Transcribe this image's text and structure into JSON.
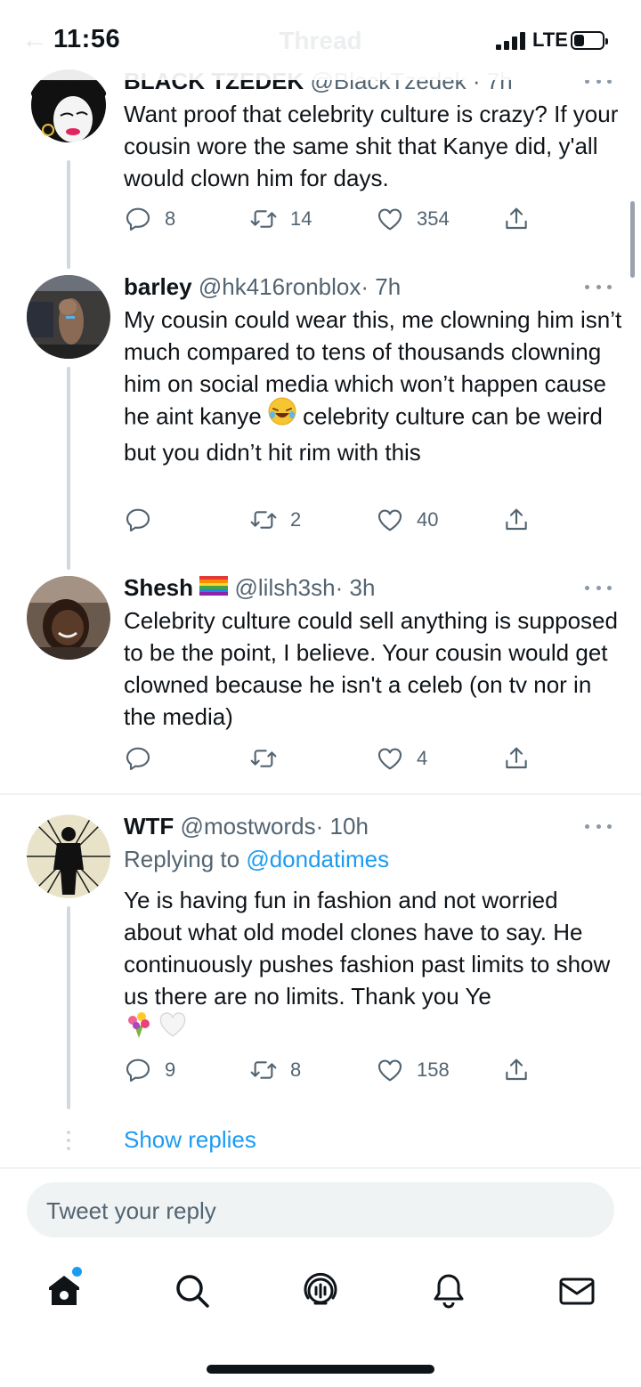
{
  "status_bar": {
    "time": "11:56",
    "network": "LTE",
    "ghost_title": "Thread",
    "battery_level": 0.35
  },
  "colors": {
    "accent": "#1d9bf0",
    "text": "#0f1419",
    "secondary": "#536471"
  },
  "tweets": [
    {
      "name": "BLACK TZEDEK",
      "handle": "@BlackTzedek",
      "time": "· 7h",
      "text": "Want proof that celebrity culture is crazy? If your cousin wore the same shit that Kanye did, y'all would clown him for days.",
      "replies": "8",
      "retweets": "14",
      "likes": "354"
    },
    {
      "name": "barley",
      "handle": "@hk416ronblox",
      "time": "· 7h",
      "text_before": "My cousin could wear this, me clowning him isn’t much compared to tens of thousands clowning him on social media which won’t happen cause he aint kanye ",
      "text_after": " celebrity culture can be weird but you didn’t hit rim with this",
      "replies": "",
      "retweets": "2",
      "likes": "40"
    },
    {
      "name": "Shesh",
      "handle": "@lilsh3sh",
      "time": "· 3h",
      "text": "Celebrity culture could sell anything is supposed to be the point, I believe. Your cousin would get clowned because he isn't a celeb (on tv nor in the media)",
      "replies": "",
      "retweets": "",
      "likes": "4"
    },
    {
      "name": "WTF",
      "handle": "@mostwords",
      "time": "· 10h",
      "replying_prefix": "Replying to ",
      "replying_to": "@dondatimes",
      "text": "Ye is having fun in fashion and not worried about what old model clones have to say. He continuously pushes fashion past limits to show us there are no limits. Thank you Ye",
      "replies": "9",
      "retweets": "8",
      "likes": "158"
    }
  ],
  "show_replies": "Show replies",
  "reply_box": {
    "placeholder": "Tweet your reply"
  },
  "icons": {
    "reply": "reply-icon",
    "retweet": "retweet-icon",
    "like": "heart-icon",
    "share": "share-icon",
    "tabs": [
      "home-icon",
      "search-icon",
      "spaces-icon",
      "bell-icon",
      "mail-icon"
    ]
  }
}
